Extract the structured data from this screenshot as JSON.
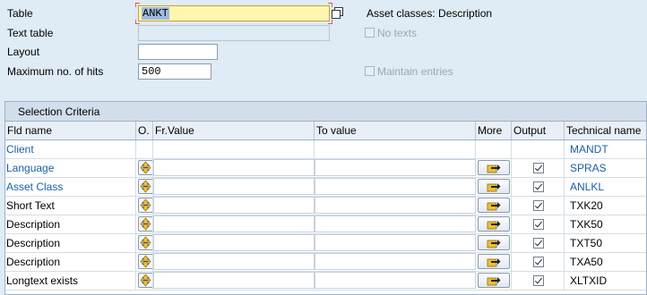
{
  "form": {
    "table_label": "Table",
    "table_value": "ANKT",
    "table_description": "Asset classes: Description",
    "text_table_label": "Text table",
    "text_table_value": "",
    "no_texts_label": "No texts",
    "layout_label": "Layout",
    "layout_value": "",
    "max_hits_label": "Maximum no. of hits",
    "max_hits_value": "500",
    "maintain_entries_label": "Maintain entries"
  },
  "criteria": {
    "caption": "Selection Criteria",
    "columns": [
      "Fld name",
      "O.",
      "Fr.Value",
      "To value",
      "More",
      "Output",
      "Technical name"
    ],
    "rows": [
      {
        "field": "Client",
        "tech": "MANDT",
        "link": true,
        "editable": false
      },
      {
        "field": "Language",
        "tech": "SPRAS",
        "link": true,
        "editable": true,
        "output": true
      },
      {
        "field": "Asset Class",
        "tech": "ANLKL",
        "link": true,
        "editable": true,
        "output": true
      },
      {
        "field": "Short Text",
        "tech": "TXK20",
        "link": false,
        "editable": true,
        "output": true
      },
      {
        "field": "Description",
        "tech": "TXK50",
        "link": false,
        "editable": true,
        "output": true
      },
      {
        "field": "Description",
        "tech": "TXT50",
        "link": false,
        "editable": true,
        "output": true
      },
      {
        "field": "Description",
        "tech": "TXA50",
        "link": false,
        "editable": true,
        "output": true
      },
      {
        "field": "Longtext exists",
        "tech": "XLTXID",
        "link": false,
        "editable": true,
        "output": true
      }
    ]
  },
  "colors": {
    "background": "#dfebf5",
    "link": "#1a5fa8",
    "focus_field": "#fff6b0"
  }
}
